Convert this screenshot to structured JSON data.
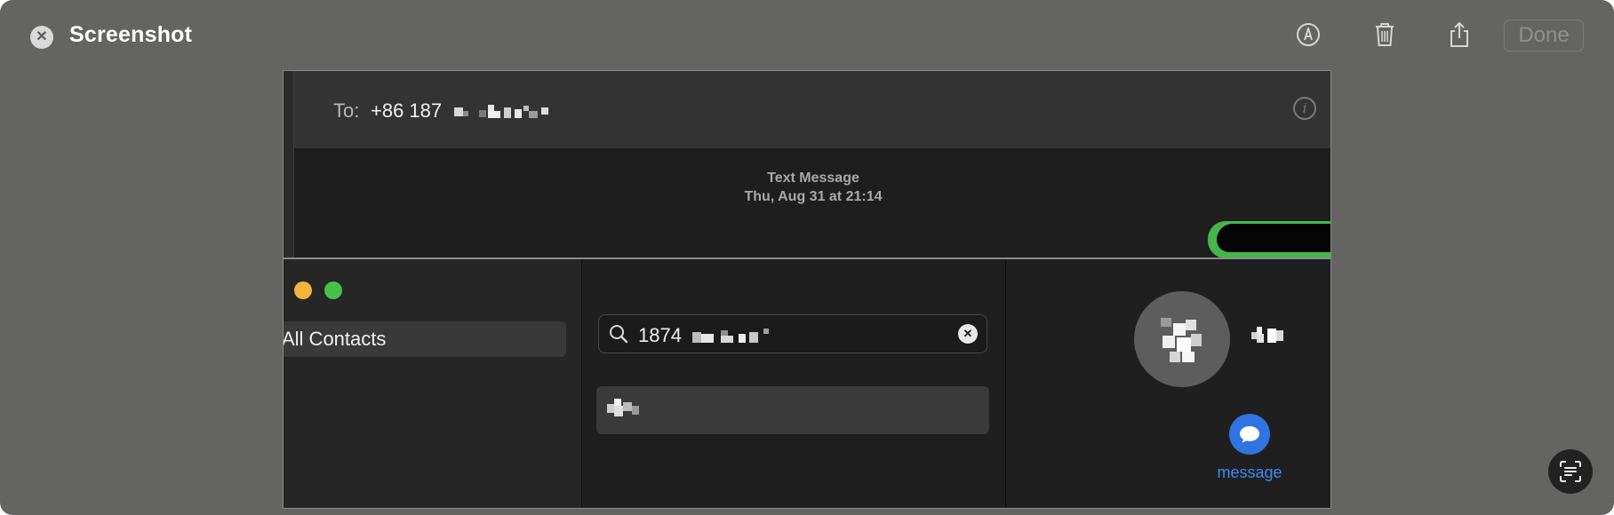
{
  "toolbar": {
    "title": "Screenshot",
    "done_label": "Done"
  },
  "messages": {
    "to_label": "To:",
    "to_value": "+86 187",
    "message_type": "Text Message",
    "timestamp": "Thu, Aug 31 at 21:14"
  },
  "contacts": {
    "sidebar_selected": "All Contacts",
    "search_value": "1874",
    "message_label": "message"
  },
  "colors": {
    "window_bg": "#646463",
    "bubble_green": "#45b64a",
    "accent_blue": "#2f74e0",
    "traffic_yellow": "#f2b53a",
    "traffic_green": "#47c04b"
  },
  "icons": {
    "close": "close-icon",
    "markup": "markup-icon",
    "trash": "trash-icon",
    "share": "share-icon",
    "info": "info-icon",
    "search": "search-icon",
    "clear": "clear-icon",
    "message": "message-bubble-icon",
    "live_text": "live-text-icon"
  }
}
